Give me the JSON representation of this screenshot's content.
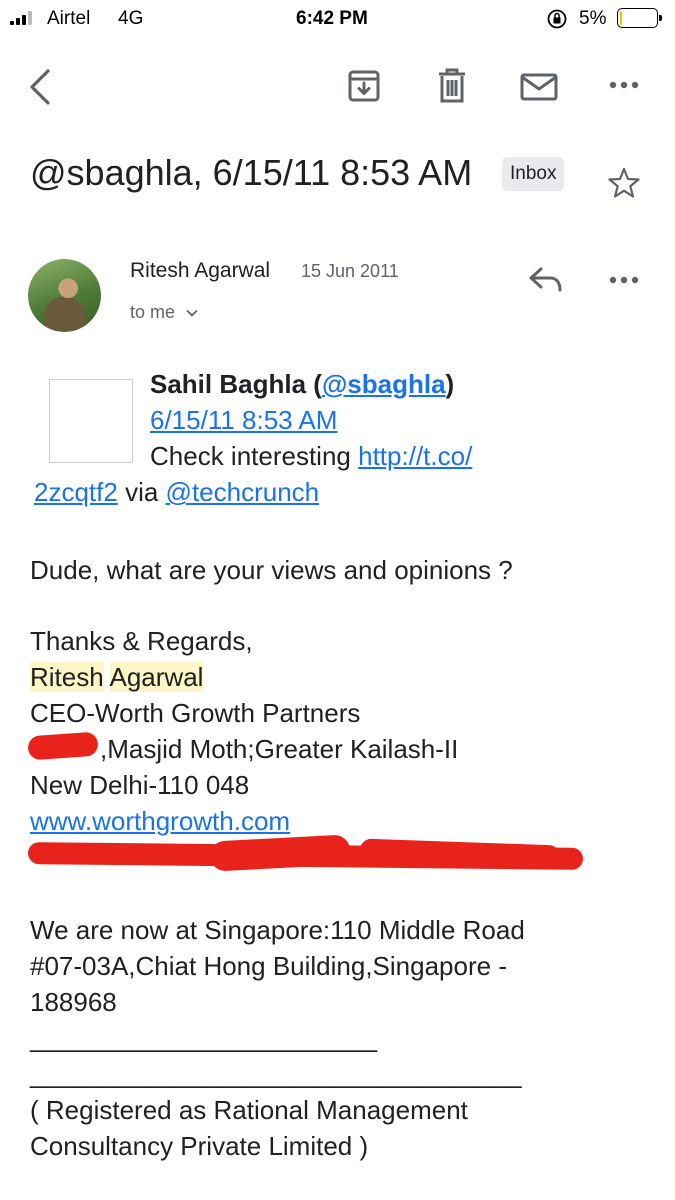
{
  "status_bar": {
    "carrier": "Airtel",
    "network": "4G",
    "time": "6:42 PM",
    "battery_percent": "5%",
    "battery_level": 0.05
  },
  "toolbar": {
    "icons": [
      "back-arrow-icon",
      "archive-icon",
      "trash-icon",
      "mail-icon",
      "more-icon"
    ]
  },
  "email": {
    "subject": "@sbaghla, 6/15/11 8:53 AM",
    "label": "Inbox",
    "sender_name": "Ritesh Agarwal",
    "date": "15 Jun 2011",
    "recipient": "to me"
  },
  "tweet": {
    "author": "Sahil Baghla",
    "handle": "@sbaghla",
    "timestamp": "6/15/11 8:53 AM",
    "text": "Check interesting",
    "link_part1": "http://t.co/",
    "link_part2": "2zcqtf2",
    "via": "via",
    "via_handle": "@techcrunch"
  },
  "message": {
    "question": "Dude, what are your views and opinions ?",
    "closing": "Thanks & Regards,",
    "sig_first": "Ritesh",
    "sig_last": "Agarwal",
    "sig_title": "CEO-Worth Growth Partners",
    "sig_address1": ",Masjid Moth;Greater Kailash-II",
    "sig_address2": "New Delhi-110 048",
    "sig_website": "www.worthgrowth.com",
    "singapore1": "We are now at Singapore:110 Middle Road",
    "singapore2": "#07-03A,Chiat Hong Building,Singapore -",
    "singapore3": "188968",
    "rule1": "________________________",
    "rule2": "__________________________________",
    "registered1": "( Registered as Rational Management",
    "registered2": "Consultancy Private Limited )"
  }
}
